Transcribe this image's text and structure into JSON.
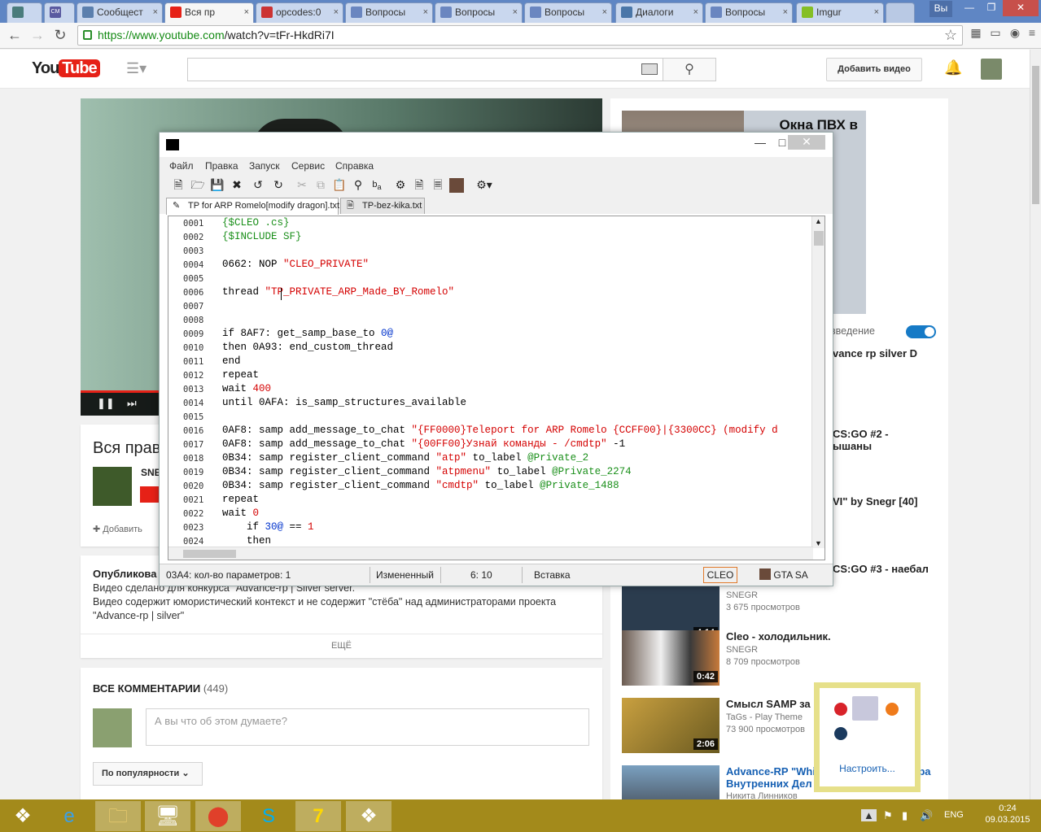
{
  "browser": {
    "tabs": [
      {
        "label": "",
        "favicon_color": "#4a7c7c"
      },
      {
        "label": "",
        "favicon_color": "#5a5aa0",
        "favicon_text": "CM"
      },
      {
        "label": "Сообщест",
        "favicon_color": "#5b7fad"
      },
      {
        "label": "Вся пр",
        "favicon_color": "#e62117",
        "active": true
      },
      {
        "label": "opcodes:0",
        "favicon_color": "#cc3333"
      },
      {
        "label": "Вопросы",
        "favicon_color": "#6a86c0"
      },
      {
        "label": "Вопросы",
        "favicon_color": "#6a86c0"
      },
      {
        "label": "Вопросы",
        "favicon_color": "#6a86c0"
      },
      {
        "label": "Диалоги",
        "favicon_color": "#4a76a8"
      },
      {
        "label": "Вопросы",
        "favicon_color": "#6a86c0"
      },
      {
        "label": "Imgur",
        "favicon_color": "#85bf25"
      }
    ],
    "user_badge": "Вы",
    "url_green": "https://www.youtube.com",
    "url_rest": "/watch?v=tFr-HkdRi7I"
  },
  "youtube": {
    "logo_you": "You",
    "logo_tube": "Tube",
    "add_video": "Добавить видео",
    "video_title": "Вся прав",
    "channel_name": "SNE",
    "add_to": "Добавить",
    "published": "Опубликова",
    "desc_lines": [
      "Видео сделано для конкурса \"Advance-rp | Silver server.\"",
      "Видео содержит юмористический контекст и не содержит \"стёба\" над администраторами проекта",
      "\"Advance-rp | silver\""
    ],
    "more": "ЕЩЁ",
    "comments_header": "ВСЕ КОММЕНТАРИИ",
    "comments_count": "(449)",
    "comment_placeholder": "А вы что об этом думаете?",
    "sort_label": "По популярности",
    "ad_text": "Окна ПВХ в",
    "autoplay_label": "введение",
    "side_partial": [
      "vance rp silver D",
      "CS:GO #2 -",
      "ышаны",
      "VI\" by Snegr [40]",
      "CS:GO #3 - наебал"
    ],
    "side_videos": [
      {
        "title": "",
        "channel": "SNEGR",
        "views": "3 675 просмотров",
        "duration": "4:14",
        "thumb_color": "#2b3c4e"
      },
      {
        "title": "Cleo - холодильник.",
        "channel": "SNEGR",
        "views": "8 709 просмотров",
        "duration": "0:42",
        "thumb_color": "#5a4a40"
      },
      {
        "title": "Смысл SAMP за",
        "channel": "TaGs - Play Theme",
        "views": "73 900 просмотров",
        "duration": "2:06",
        "thumb_color": "#7a6a30"
      },
      {
        "title": "Advance-RP \"Whi",
        "title2": "Внутренних Дел",
        "title_suffix": "тра",
        "channel": "Никита Линников",
        "views": "",
        "duration": "",
        "thumb_color": "#557799"
      }
    ]
  },
  "sanny": {
    "menu": [
      "Файл",
      "Правка",
      "Запуск",
      "Сервис",
      "Справка"
    ],
    "tabs": [
      "TP for ARP Romelo[modify dragon].txt",
      "TP-bez-kika.txt"
    ],
    "lines": [
      {
        "n": "0001",
        "parts": [
          {
            "c": "k-dir",
            "t": "{$CLEO .cs}"
          }
        ]
      },
      {
        "n": "0002",
        "parts": [
          {
            "c": "k-dir",
            "t": "{$INCLUDE SF}"
          }
        ]
      },
      {
        "n": "0003",
        "parts": []
      },
      {
        "n": "0004",
        "parts": [
          {
            "c": "",
            "t": "0662: NOP "
          },
          {
            "c": "k-str",
            "t": "\"CLEO_PRIVATE\""
          }
        ]
      },
      {
        "n": "0005",
        "parts": []
      },
      {
        "n": "0006",
        "parts": [
          {
            "c": "",
            "t": "thread "
          },
          {
            "c": "k-str",
            "t": "\"TP_PRIVATE_ARP_Made_BY_Romelo\""
          }
        ]
      },
      {
        "n": "0007",
        "parts": []
      },
      {
        "n": "0008",
        "parts": []
      },
      {
        "n": "0009",
        "parts": [
          {
            "c": "",
            "t": "if 8AF7: get_samp_base_to "
          },
          {
            "c": "k-var",
            "t": "0@"
          }
        ]
      },
      {
        "n": "0010",
        "parts": [
          {
            "c": "",
            "t": "then 0A93: end_custom_thread"
          }
        ]
      },
      {
        "n": "0011",
        "parts": [
          {
            "c": "",
            "t": "end"
          }
        ]
      },
      {
        "n": "0012",
        "parts": [
          {
            "c": "",
            "t": "repeat"
          }
        ]
      },
      {
        "n": "0013",
        "parts": [
          {
            "c": "",
            "t": "wait "
          },
          {
            "c": "k-num",
            "t": "400"
          }
        ]
      },
      {
        "n": "0014",
        "parts": [
          {
            "c": "",
            "t": "until 0AFA: is_samp_structures_available"
          }
        ]
      },
      {
        "n": "0015",
        "parts": []
      },
      {
        "n": "0016",
        "parts": [
          {
            "c": "",
            "t": "0AF8: samp add_message_to_chat "
          },
          {
            "c": "k-str",
            "t": "\"{FF0000}Teleport for ARP Romelo {CCFF00}|{3300CC} (modify d"
          }
        ]
      },
      {
        "n": "0017",
        "parts": [
          {
            "c": "",
            "t": "0AF8: samp add_message_to_chat "
          },
          {
            "c": "k-str",
            "t": "\"{00FF00}Узнай команды - /cmdtp\""
          },
          {
            "c": "",
            "t": " -1"
          }
        ]
      },
      {
        "n": "0018",
        "parts": [
          {
            "c": "",
            "t": "0B34: samp register_client_command "
          },
          {
            "c": "k-str",
            "t": "\"atp\""
          },
          {
            "c": "",
            "t": " to_label "
          },
          {
            "c": "k-lbl",
            "t": "@Private_2"
          }
        ]
      },
      {
        "n": "0019",
        "parts": [
          {
            "c": "",
            "t": "0B34: samp register_client_command "
          },
          {
            "c": "k-str",
            "t": "\"atpmenu\""
          },
          {
            "c": "",
            "t": " to_label "
          },
          {
            "c": "k-lbl",
            "t": "@Private_2274"
          }
        ]
      },
      {
        "n": "0020",
        "parts": [
          {
            "c": "",
            "t": "0B34: samp register_client_command "
          },
          {
            "c": "k-str",
            "t": "\"cmdtp\""
          },
          {
            "c": "",
            "t": " to_label "
          },
          {
            "c": "k-lbl",
            "t": "@Private_1488"
          }
        ]
      },
      {
        "n": "0021",
        "parts": [
          {
            "c": "",
            "t": "repeat"
          }
        ]
      },
      {
        "n": "0022",
        "parts": [
          {
            "c": "",
            "t": "wait "
          },
          {
            "c": "k-num",
            "t": "0"
          }
        ]
      },
      {
        "n": "0023",
        "parts": [
          {
            "c": "",
            "t": "    if "
          },
          {
            "c": "k-var",
            "t": "30@"
          },
          {
            "c": "",
            "t": " == "
          },
          {
            "c": "k-num",
            "t": "1"
          }
        ]
      },
      {
        "n": "0024",
        "parts": [
          {
            "c": "",
            "t": "    then"
          }
        ]
      }
    ],
    "status": {
      "hint": "03A4: кол-во параметров: 1",
      "modified": "Измененный",
      "position": "6: 10",
      "mode": "Вставка",
      "cleo": "CLEO",
      "game": "GTA SA"
    }
  },
  "tray_popup": {
    "customize": "Настроить..."
  },
  "taskbar": {
    "lang": "ENG",
    "time": "0:24",
    "date": "09.03.2015"
  }
}
